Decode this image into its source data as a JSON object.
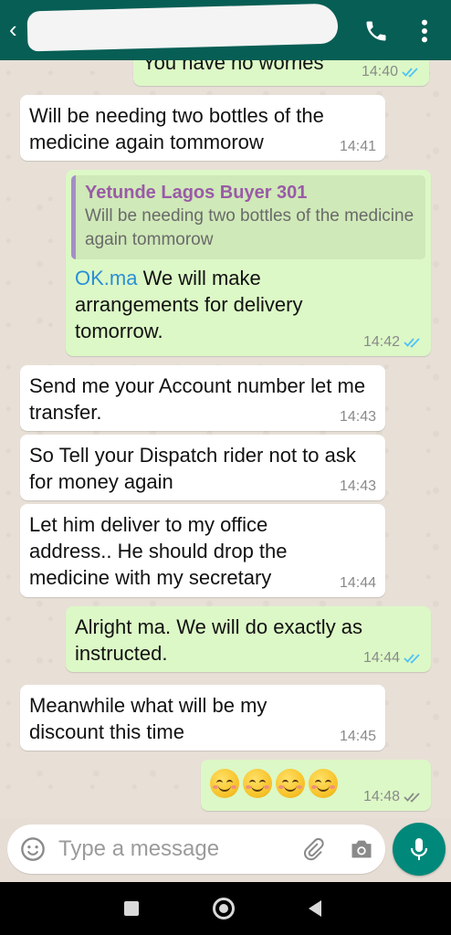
{
  "header": {
    "back_glyph": "‹",
    "icons": [
      "back-arrow-icon",
      "call-icon",
      "more-vert-icon"
    ],
    "accent": "#075e54"
  },
  "messages": [
    {
      "direction": "out",
      "text": "You have no worries",
      "time": "14:40",
      "ticks": "read"
    },
    {
      "direction": "in",
      "text": "Will be needing two bottles of the medicine again tommorow",
      "time": "14:41"
    },
    {
      "direction": "out",
      "quote": {
        "name": "Yetunde Lagos Buyer 301",
        "text": "Will be needing two bottles of the medicine again tommorow"
      },
      "link": "OK.ma",
      "text": " We will make arrangements for delivery tomorrow.",
      "time": "14:42",
      "ticks": "read"
    },
    {
      "direction": "in",
      "text": "Send me your Account number let me transfer.",
      "time": "14:43"
    },
    {
      "direction": "in",
      "text": "So Tell your Dispatch rider not to ask for money again",
      "time": "14:43"
    },
    {
      "direction": "in",
      "text": "Let him deliver to my office address.. He should drop the medicine with my secretary",
      "time": "14:44"
    },
    {
      "direction": "out",
      "text": "Alright ma. We will do exactly as instructed.",
      "time": "14:44",
      "ticks": "read"
    },
    {
      "direction": "in",
      "text": "Meanwhile what will be my discount this time",
      "time": "14:45"
    },
    {
      "direction": "out",
      "emoji": [
        "☺",
        "☺",
        "☺",
        "☺"
      ],
      "time": "14:48",
      "ticks": "delivered"
    }
  ],
  "composer": {
    "placeholder": "Type a message",
    "icons": [
      "emoji-icon",
      "attach-icon",
      "camera-icon",
      "mic-icon"
    ]
  },
  "colors": {
    "incoming_bubble": "#ffffff",
    "outgoing_bubble": "#dcf8c6",
    "read_ticks": "#4fc3f7",
    "delivered_ticks": "#8a8a8a",
    "quote_name": "#9a5aa7",
    "link": "#2a8fd8",
    "mic_button": "#00897b"
  },
  "system_nav": [
    "recent-apps-icon",
    "home-icon",
    "back-icon"
  ]
}
